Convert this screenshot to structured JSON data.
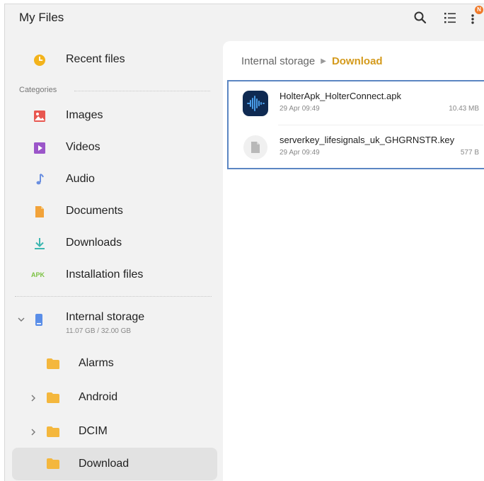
{
  "app": {
    "title": "My Files",
    "badge": "N",
    "colors": {
      "accent": "#d49a1c",
      "selection_border": "#5b86c2"
    }
  },
  "sidebar": {
    "recent": {
      "label": "Recent files",
      "icon": "clock-icon"
    },
    "categories_header": "Categories",
    "categories": [
      {
        "label": "Images",
        "icon": "image-icon",
        "color": "#e8564f"
      },
      {
        "label": "Videos",
        "icon": "video-icon",
        "color": "#9b56c9"
      },
      {
        "label": "Audio",
        "icon": "music-note-icon",
        "color": "#6a8fe0"
      },
      {
        "label": "Documents",
        "icon": "document-icon",
        "color": "#f2a33a"
      },
      {
        "label": "Downloads",
        "icon": "download-icon",
        "color": "#3cb6b0"
      },
      {
        "label": "Installation files",
        "icon": "apk-icon",
        "icon_text": "APK",
        "color": "#7cc243"
      }
    ],
    "storage": {
      "label": "Internal storage",
      "usage": "11.07 GB / 32.00 GB",
      "icon": "phone-icon"
    },
    "folders": [
      {
        "label": "Alarms",
        "expandable": false
      },
      {
        "label": "Android",
        "expandable": true
      },
      {
        "label": "DCIM",
        "expandable": true
      },
      {
        "label": "Download",
        "expandable": false,
        "selected": true
      }
    ]
  },
  "main": {
    "breadcrumb": {
      "root": "Internal storage",
      "current": "Download"
    },
    "files": [
      {
        "name": "HolterApk_HolterConnect.apk",
        "date": "29 Apr 09:49",
        "size": "10.43 MB",
        "icon": "apk-waveform-icon"
      },
      {
        "name": "serverkey_lifesignals_uk_GHGRNSTR.key",
        "date": "29 Apr 09:49",
        "size": "577 B",
        "icon": "file-icon"
      }
    ]
  }
}
